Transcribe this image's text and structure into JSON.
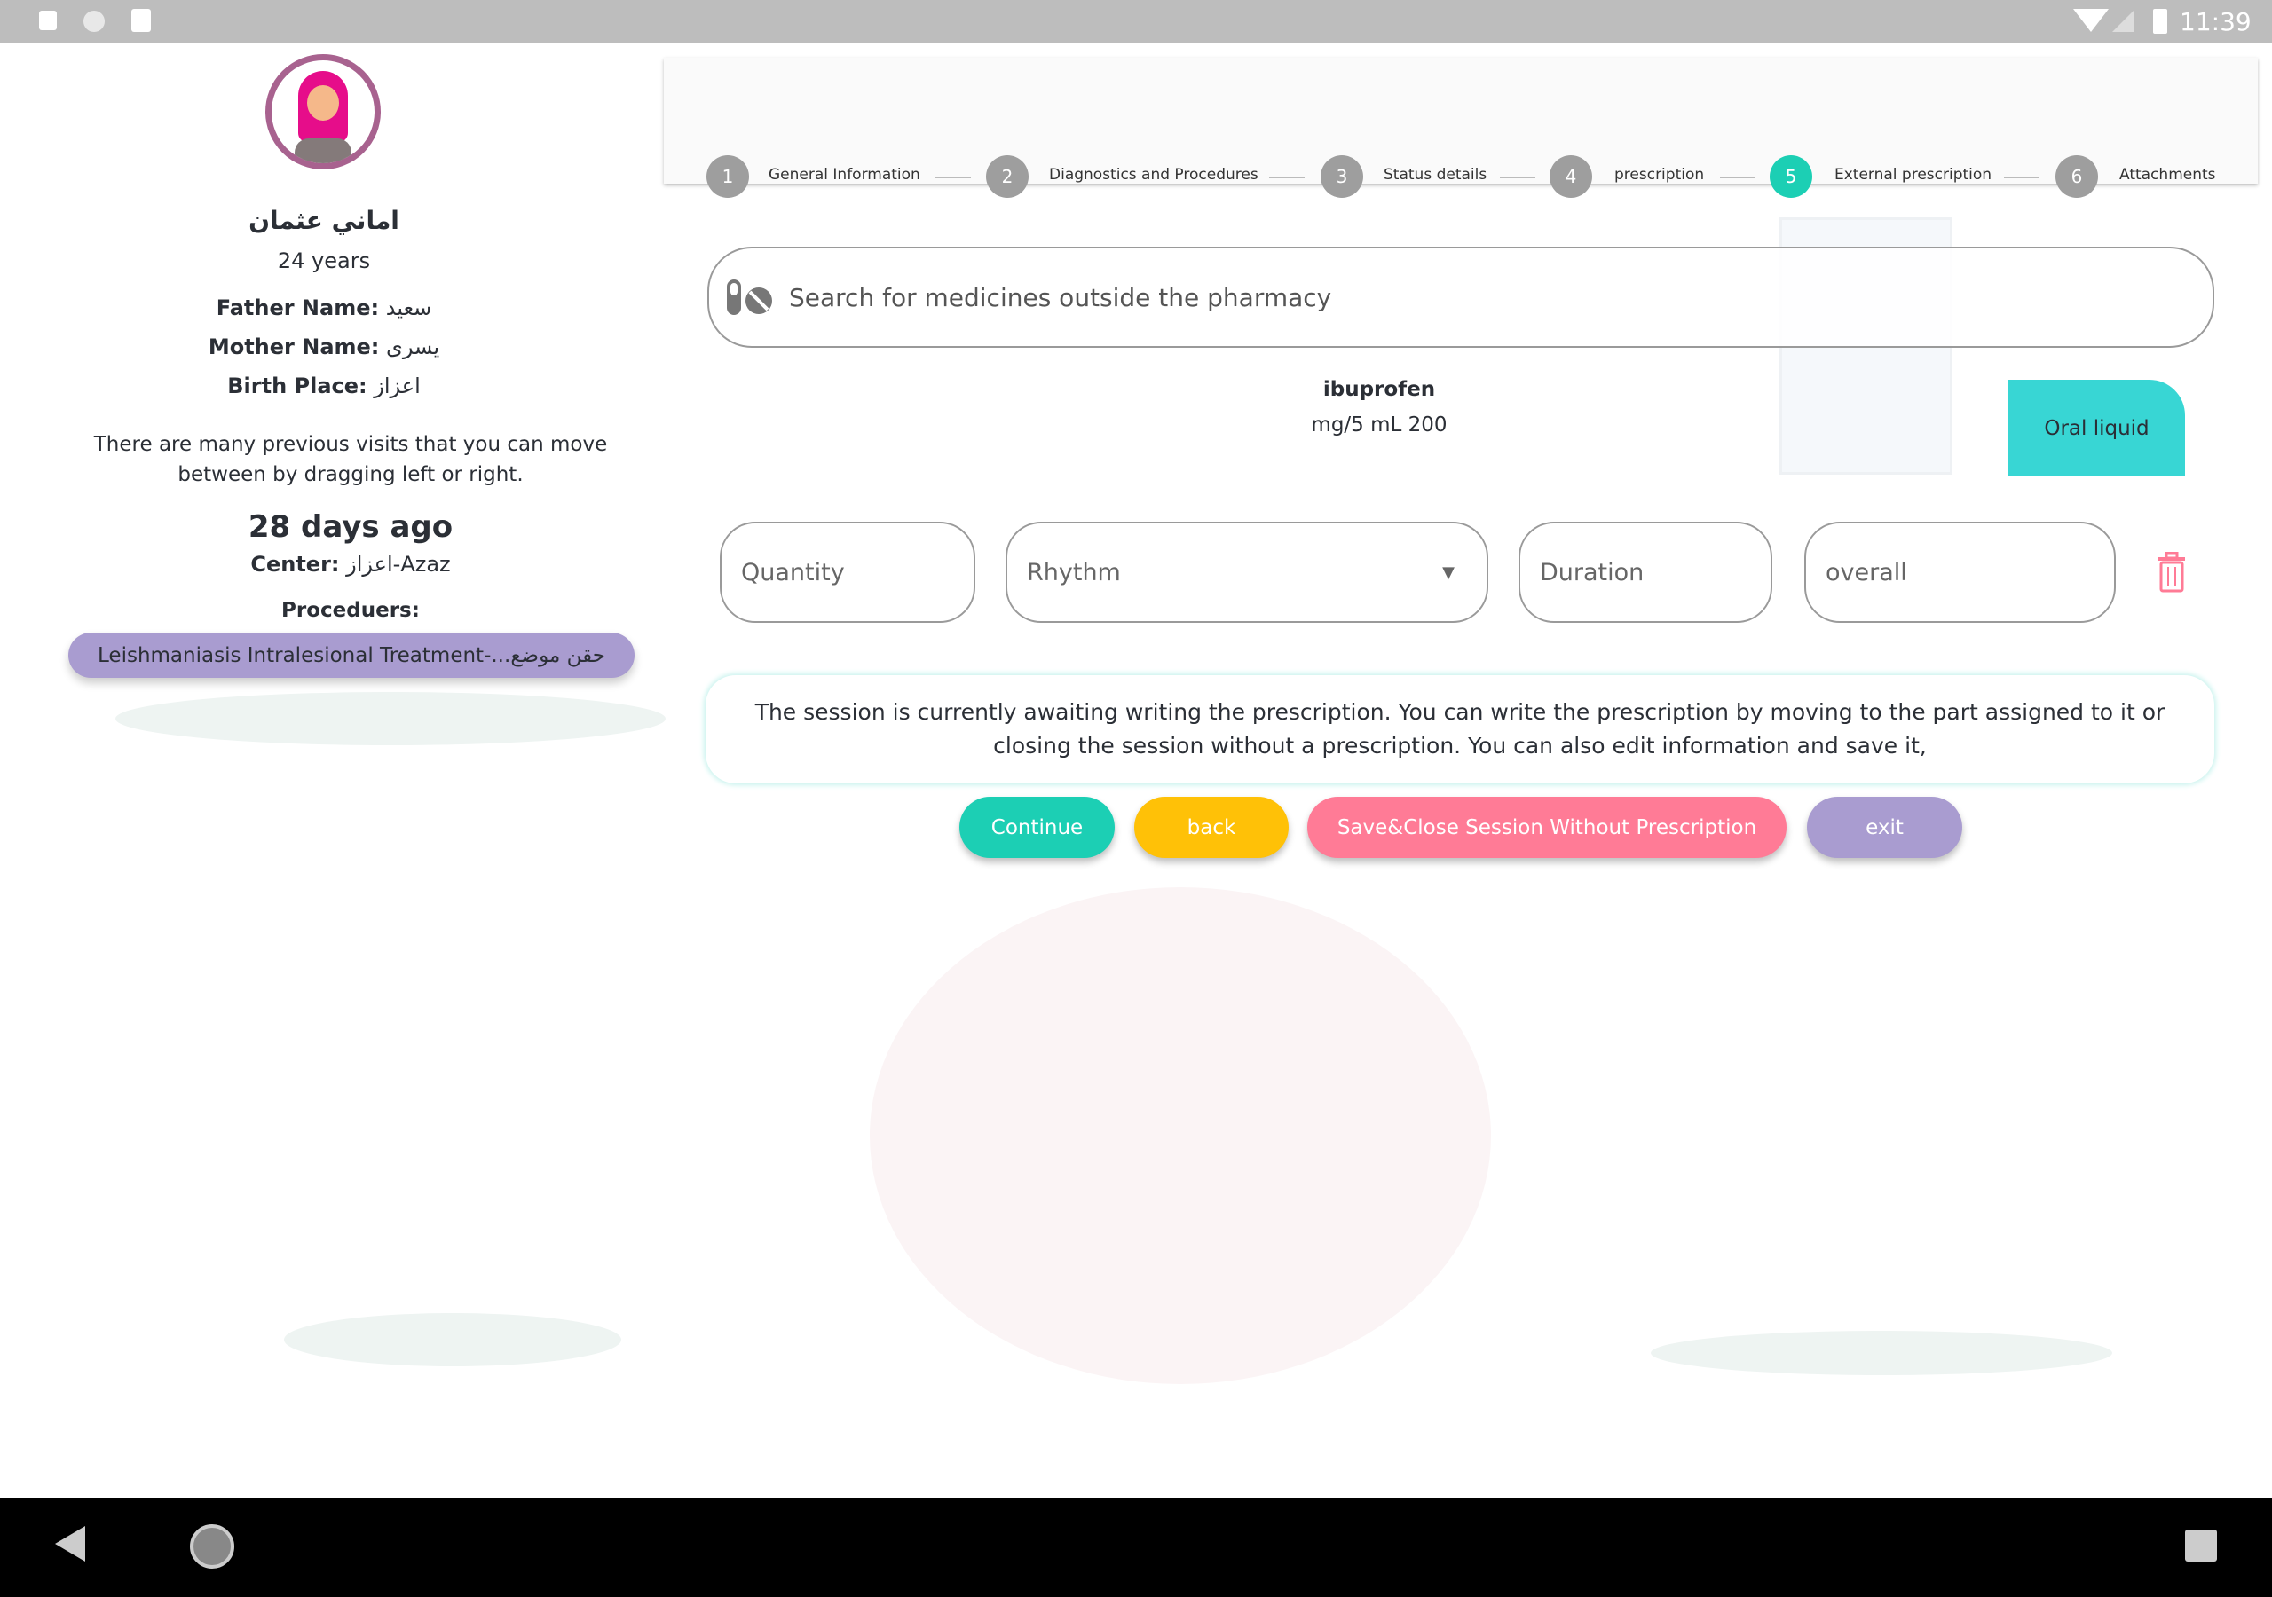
{
  "status_bar": {
    "time": "11:39"
  },
  "patient": {
    "name": "اماني عثمان",
    "age": "24 years",
    "father_label": "Father Name:",
    "father": "سعيد",
    "mother_label": "Mother Name:",
    "mother": "يسرى",
    "birth_label": "Birth Place:",
    "birth": "اعزاز",
    "visits_hint": "There are many previous visits that you can move between by dragging left or right.",
    "visit_time": "28 days ago",
    "center_label": "Center:",
    "center": "اعزاز-Azaz",
    "procedures_label": "Proceduers:",
    "procedure": "Leishmaniasis Intralesional Treatment-...حقن موضع"
  },
  "stepper": {
    "active": 5,
    "steps": [
      {
        "num": "1",
        "label": "General Information"
      },
      {
        "num": "2",
        "label": "Diagnostics and Procedures"
      },
      {
        "num": "3",
        "label": "Status details"
      },
      {
        "num": "4",
        "label": "prescription"
      },
      {
        "num": "5",
        "label": "External prescription"
      },
      {
        "num": "6",
        "label": "Attachments"
      }
    ]
  },
  "search": {
    "placeholder": "Search for medicines outside the pharmacy",
    "icon": "pills-icon"
  },
  "medicine": {
    "name": "ibuprofen",
    "dose": "mg/5 mL 200",
    "form": "Oral liquid"
  },
  "fields": {
    "quantity": "Quantity",
    "rhythm": "Rhythm",
    "duration": "Duration",
    "overall": "overall"
  },
  "message": "The session is currently awaiting writing the prescription. You can write the prescription by moving to the part assigned to it or closing the session without a prescription. You can also edit information and save it,",
  "buttons": {
    "continue": "Continue",
    "back": "back",
    "save_close": "Save&Close Session Without Prescription",
    "exit": "exit"
  },
  "colors": {
    "teal": "#1ccfb4",
    "yellow": "#ffc107",
    "pink": "#ff7b96",
    "purple": "#a99cd0",
    "oral": "#38d6d4"
  }
}
